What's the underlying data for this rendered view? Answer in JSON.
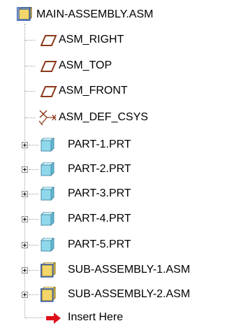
{
  "tree": {
    "root": {
      "label": "MAIN-ASSEMBLY.ASM",
      "icon": "assembly-icon"
    },
    "datums": [
      {
        "label": "ASM_RIGHT",
        "icon": "datum-plane-icon"
      },
      {
        "label": "ASM_TOP",
        "icon": "datum-plane-icon"
      },
      {
        "label": "ASM_FRONT",
        "icon": "datum-plane-icon"
      },
      {
        "label": "ASM_DEF_CSYS",
        "icon": "coordinate-system-icon"
      }
    ],
    "parts": [
      {
        "label": "PART-1.PRT",
        "icon": "part-icon"
      },
      {
        "label": "PART-2.PRT",
        "icon": "part-icon"
      },
      {
        "label": "PART-3.PRT",
        "icon": "part-icon"
      },
      {
        "label": "PART-4.PRT",
        "icon": "part-icon"
      },
      {
        "label": "PART-5.PRT",
        "icon": "part-icon"
      }
    ],
    "subassemblies": [
      {
        "label": "SUB-ASSEMBLY-1.ASM",
        "icon": "assembly-icon"
      },
      {
        "label": "SUB-ASSEMBLY-2.ASM",
        "icon": "assembly-icon"
      }
    ],
    "insert_here": {
      "label": "Insert Here",
      "icon": "insert-arrow-icon"
    }
  },
  "colors": {
    "part_cube": "#8fd8ec",
    "assembly_cube": "#f2d66a",
    "datum_plane": "#8b3a1a",
    "insert_arrow": "#e0101a"
  }
}
